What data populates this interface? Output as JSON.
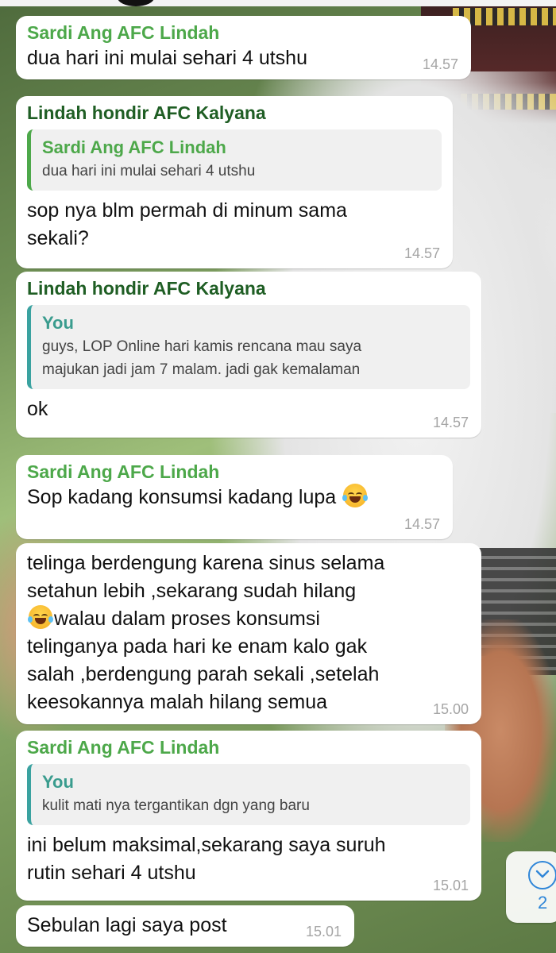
{
  "messages": [
    {
      "sender": "Sardi Ang AFC Lindah",
      "text": "dua hari ini mulai sehari 4 utshu",
      "time": "14.57"
    },
    {
      "sender": "Lindah hondir AFC Kalyana",
      "quote": {
        "name": "Sardi Ang AFC Lindah",
        "text": "dua hari ini mulai sehari 4 utshu"
      },
      "text_lines": [
        "sop nya blm permah di minum sama",
        "sekali?"
      ],
      "time": "14.57"
    },
    {
      "sender": "Lindah hondir AFC Kalyana",
      "quote": {
        "name": "You",
        "text_lines": [
          "guys, LOP Online hari kamis rencana mau saya",
          "majukan jadi jam 7 malam. jadi gak kemalaman"
        ]
      },
      "text": "ok",
      "time": "14.57"
    },
    {
      "sender": "Sardi Ang AFC Lindah",
      "text": "Sop kadang konsumsi kadang lupa",
      "emoji": "face-with-tears-of-joy",
      "time": "14.57"
    },
    {
      "text_lines": [
        "telinga berdengung karena sinus selama",
        "setahun lebih  ,sekarang sudah hilang",
        "walau dalam proses konsumsi",
        "telinganya pada hari ke enam kalo gak",
        "salah ,berdengung parah sekali ,setelah",
        "keesokannya malah hilang semua"
      ],
      "emoji": "face-with-tears-of-joy",
      "time": "15.00"
    },
    {
      "sender": "Sardi Ang AFC Lindah",
      "quote": {
        "name": "You",
        "text": "kulit mati nya tergantikan dgn yang baru"
      },
      "text_lines": [
        "ini belum maksimal,sekarang saya suruh",
        "rutin sehari 4 utshu"
      ],
      "time": "15.01"
    },
    {
      "text": "Sebulan lagi saya post",
      "time": "15.01"
    }
  ],
  "scroll_button": {
    "icon": "chevron-down-icon",
    "unread_count": "2"
  },
  "colors": {
    "sender_green": "#4da84a",
    "sender_dark": "#1f5e24",
    "quote_teal": "#3a9c8e",
    "time_gray": "#a5a5a5",
    "accent_blue": "#2f86d8"
  }
}
